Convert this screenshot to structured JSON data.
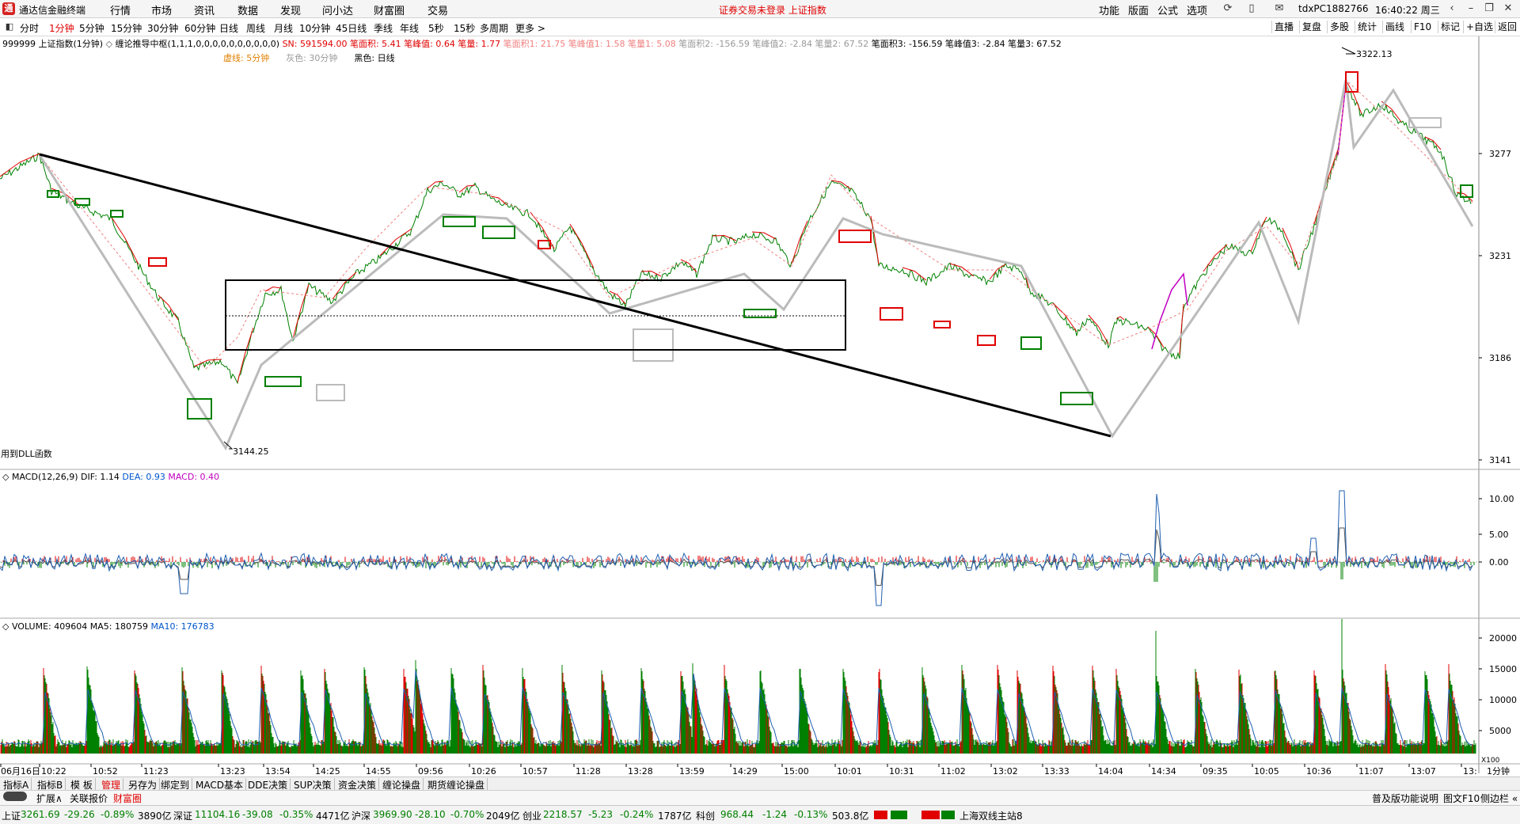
{
  "menubar": {
    "app_title": "通达信金融终端",
    "menus": [
      "行情",
      "市场",
      "资讯",
      "数据",
      "发现",
      "问小达",
      "财富圈",
      "交易"
    ],
    "warning": "证券交易未登录  上证指数",
    "right_menus": [
      "功能",
      "版面",
      "公式",
      "选项"
    ],
    "account": "tdxPC1882766",
    "clock": "16:40:22 周三"
  },
  "toolbar": {
    "periods": [
      "分时",
      "1分钟",
      "5分钟",
      "15分钟",
      "30分钟",
      "60分钟",
      "日线",
      "周线",
      "月线",
      "10分钟",
      "45日线",
      "季线",
      "年线",
      "5秒",
      "15秒",
      "多周期",
      "更多 >"
    ],
    "active_period": "1分钟",
    "right_tools": [
      "直播",
      "复盘",
      "多股",
      "统计",
      "画线",
      "F10",
      "标记",
      "+自选",
      "返回"
    ]
  },
  "main_chart": {
    "header": {
      "symbol": "999999 上证指数(1分钟)",
      "indicator": "缠论推导中枢(1,1,1,0,0,0,0,0,0,0,0,0,0)",
      "sn": "SN: 591594.00",
      "bm1": "笔面积: 5.41",
      "bf1": "笔峰值: 0.64",
      "bl1": "笔量: 1.77",
      "bm2": "笔面积1: 21.75",
      "bf2": "笔峰值1: 1.58",
      "bl2": "笔量1: 5.08",
      "bm3": "笔面积2: -156.59",
      "bf3": "笔峰值2: -2.84",
      "bl3": "笔量2: 67.52",
      "bm4": "笔面积3: -156.59",
      "bf4": "笔峰值3: -2.84",
      "bl4": "笔量3: 67.52"
    },
    "legend2": {
      "dash": "虚线: 5分钟",
      "gray": "灰色: 30分钟",
      "black": "黑色: 日线"
    },
    "price_labels": [
      "3277",
      "3231",
      "3186",
      "3141"
    ],
    "high_label": "3322.13",
    "low_label": "3144.25",
    "footnote": "用到DLL函数",
    "colors": {
      "up": "#e00000",
      "down": "#008000",
      "pen": "#bbbbbb",
      "trend": "#000000",
      "purple": "#c000c0"
    }
  },
  "macd": {
    "title": "MACD(12,26,9)",
    "dif": "DIF: 1.14",
    "dea": "DEA: 0.93",
    "macd": "MACD: 0.40",
    "axis": [
      "10.00",
      "5.00",
      "0.00"
    ]
  },
  "volume": {
    "title": "VOLUME: 409604",
    "ma5": "MA5: 180759",
    "ma10": "MA10: 176783",
    "axis": [
      "20000",
      "15000",
      "10000",
      "5000"
    ],
    "unit": "X100"
  },
  "time_axis": [
    "06月16日",
    "10:22",
    "10:52",
    "11:23",
    "13:23",
    "13:54",
    "14:25",
    "14:55",
    "09:56",
    "10:26",
    "10:57",
    "11:28",
    "13:28",
    "13:59",
    "14:29",
    "15:00",
    "10:01",
    "10:31",
    "11:02",
    "13:02",
    "13:33",
    "14:04",
    "14:34",
    "09:35",
    "10:05",
    "10:36",
    "11:07",
    "13:07",
    "13:"
  ],
  "time_axis_right": "1分钟",
  "tabs": [
    "指标A",
    "指标B",
    "模 板",
    "管理",
    "另存为",
    "绑定到",
    "MACD基本",
    "DDE决策",
    "SUP决策",
    "资金决策",
    "缠论操盘",
    "期货缠论操盘"
  ],
  "subbar": {
    "items": [
      "扩展∧",
      "关联报价",
      "财富圈"
    ],
    "right": [
      "普及版功能说明",
      "图文F10",
      "侧边栏 «"
    ]
  },
  "status": {
    "sh_name": "上证",
    "sh_val": "3261.69",
    "sh_chg": "-29.26",
    "sh_pct": "-0.89%",
    "sh_amt": "3890亿",
    "sz_name": "深证",
    "sz_val": "11104.16",
    "sz_chg": "-39.08",
    "sz_pct": "-0.35%",
    "sz_amt": "4471亿",
    "hs_name": "沪深",
    "hs_val": "3969.90",
    "hs_chg": "-28.10",
    "hs_pct": "-0.70%",
    "hs_amt": "2049亿",
    "cy_name": "创业",
    "cy_val": "2218.57",
    "cy_chg": "-5.23",
    "cy_pct": "-0.24%",
    "cy_amt": "1787亿",
    "kc_name": "科创",
    "kc_val": "968.44",
    "kc_chg": "-1.24",
    "kc_pct": "-0.13%",
    "kc_amt": "503.8亿",
    "server": "上海双线主站8"
  }
}
